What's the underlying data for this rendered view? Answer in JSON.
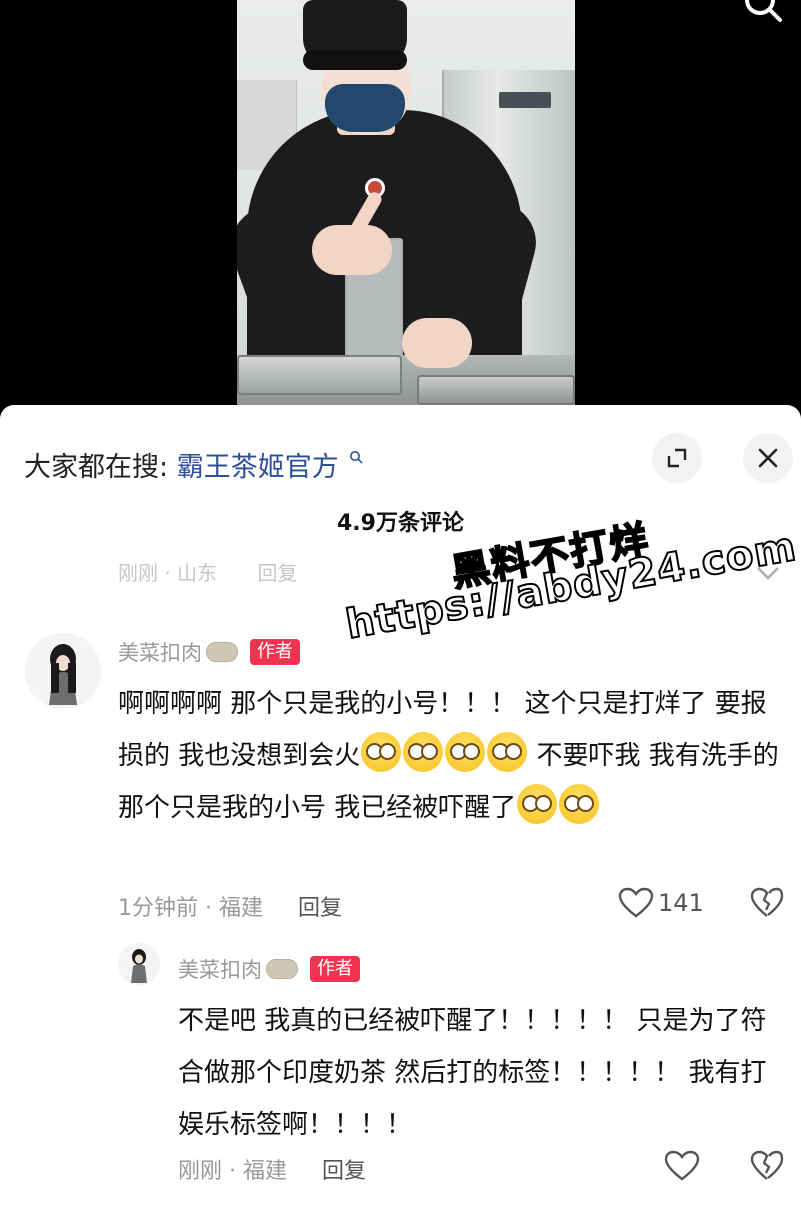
{
  "search_bar": {
    "prefix": "大家都在搜:",
    "keyword": "霸王茶姬官方"
  },
  "comments_header": {
    "count_label": "4.9万条评论"
  },
  "previous_comment_meta": {
    "time_location": "刚刚 · 山东",
    "reply_label": "回复"
  },
  "watermark": {
    "line1": "黑料不打烊",
    "line2": "https://abdy24.com"
  },
  "comments": [
    {
      "username": "美菜扣肉",
      "author_tag": "作者",
      "text_segments": [
        "啊啊啊啊 那个只是我的小号！！！ 这个只是打烊了 要报损的 我也没想到会火",
        "不要吓我 我有洗手的那个只是我的小号 我已经被吓醒了"
      ],
      "time_location": "1分钟前 · 福建",
      "reply_label": "回复",
      "like_count": "141",
      "reply": {
        "username": "美菜扣肉",
        "author_tag": "作者",
        "text": "不是吧 我真的已经被吓醒了！！！！！ 只是为了符合做那个印度奶茶 然后打的标签！！！！！ 我有打娱乐标签啊！！！！",
        "time_location": "刚刚 · 福建",
        "reply_label": "回复"
      }
    }
  ],
  "icons": {
    "top_search": "search-icon",
    "expand": "expand-icon",
    "close": "close-icon",
    "like": "heart-icon",
    "dislike": "broken-heart-icon"
  }
}
